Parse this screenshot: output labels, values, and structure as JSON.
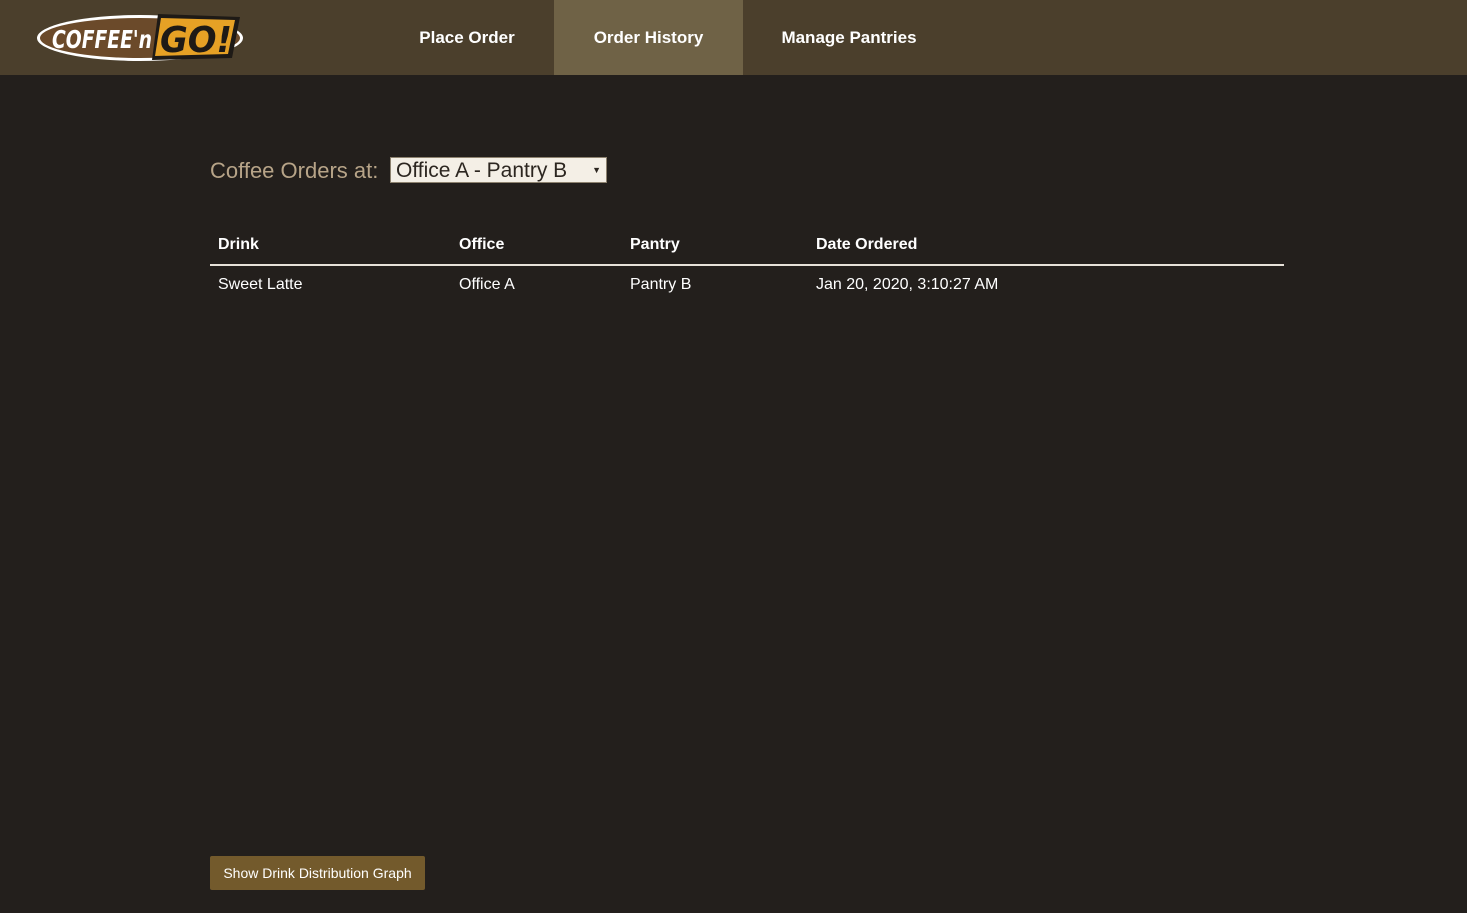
{
  "brand": {
    "logo_text_left": "COFFEE'n",
    "logo_text_right": "GO!",
    "colors": {
      "nav_bg": "#4b3f2c",
      "nav_active_bg": "#6f6246",
      "page_bg": "#231f1c",
      "logo_brown": "#6b4a2a",
      "logo_gold": "#e6a125",
      "button_bg": "#735a2c"
    }
  },
  "nav": {
    "items": [
      {
        "label": "Place Order",
        "active": false
      },
      {
        "label": "Order History",
        "active": true
      },
      {
        "label": "Manage Pantries",
        "active": false
      }
    ]
  },
  "filter": {
    "label": "Coffee Orders at:",
    "selected": "Office A - Pantry B",
    "arrow_icon": "triangle-down-icon"
  },
  "table": {
    "columns": [
      "Drink",
      "Office",
      "Pantry",
      "Date Ordered"
    ],
    "rows": [
      [
        "Sweet Latte",
        "Office A",
        "Pantry B",
        "Jan 20, 2020, 3:10:27 AM"
      ]
    ]
  },
  "actions": {
    "graph_button_label": "Show Drink Distribution Graph"
  }
}
